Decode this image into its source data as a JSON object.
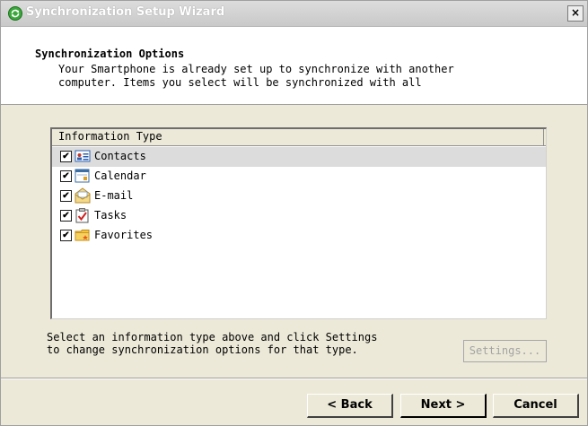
{
  "window": {
    "title": "Synchronization Setup Wizard",
    "close_label": "×"
  },
  "header": {
    "title": "Synchronization Options",
    "description_line1": "Your Smartphone is already set up to synchronize with another",
    "description_line2": "computer. Items you select will be synchronized with all"
  },
  "list": {
    "column_header": "Information Type",
    "items": [
      {
        "label": "Contacts",
        "checked": true,
        "icon": "contacts-icon"
      },
      {
        "label": "Calendar",
        "checked": true,
        "icon": "calendar-icon"
      },
      {
        "label": "E-mail",
        "checked": true,
        "icon": "email-icon"
      },
      {
        "label": "Tasks",
        "checked": true,
        "icon": "tasks-icon"
      },
      {
        "label": "Favorites",
        "checked": true,
        "icon": "favorites-icon"
      }
    ],
    "selected_index": 0
  },
  "help": {
    "line1": "Select an information type above and click Settings",
    "line2": "to change synchronization options for that type."
  },
  "buttons": {
    "settings": "Settings...",
    "back": "< Back",
    "next": "Next >",
    "cancel": "Cancel"
  },
  "colors": {
    "accent": "#2aa52a",
    "selection": "#dcdcdc"
  }
}
